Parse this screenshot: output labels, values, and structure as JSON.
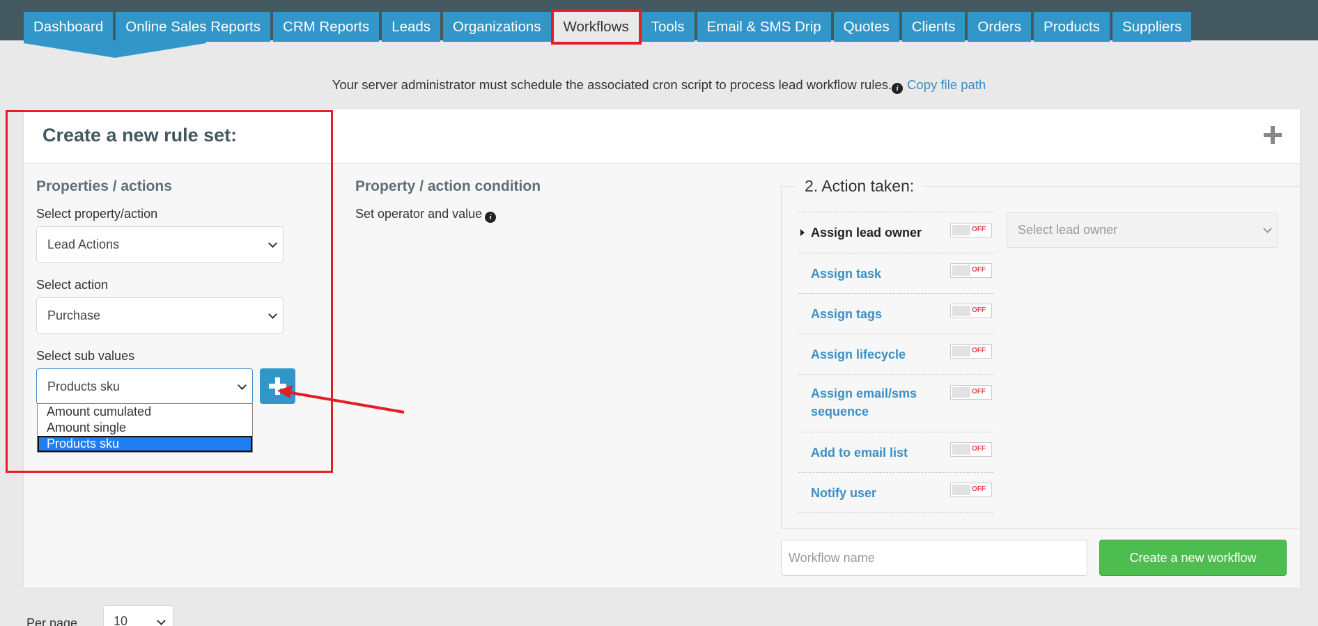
{
  "nav": {
    "items": [
      {
        "label": "Dashboard"
      },
      {
        "label": "Online Sales Reports"
      },
      {
        "label": "CRM Reports"
      },
      {
        "label": "Leads"
      },
      {
        "label": "Organizations"
      },
      {
        "label": "Workflows",
        "active": true
      },
      {
        "label": "Tools"
      },
      {
        "label": "Email & SMS Drip"
      },
      {
        "label": "Quotes"
      },
      {
        "label": "Clients"
      },
      {
        "label": "Orders"
      },
      {
        "label": "Products"
      },
      {
        "label": "Suppliers"
      }
    ]
  },
  "notice": {
    "text": "Your server administrator must schedule the associated cron script to process lead workflow rules.",
    "info_icon": "i",
    "link": "Copy file path"
  },
  "card": {
    "title": "Create a new rule set:",
    "properties": {
      "heading": "Properties / actions",
      "property_label": "Select property/action",
      "property_value": "Lead Actions",
      "action_label": "Select action",
      "action_value": "Purchase",
      "sub_label": "Select sub values",
      "sub_value": "Products sku",
      "sub_options": [
        "Amount cumulated",
        "Amount single",
        "Products sku"
      ]
    },
    "condition": {
      "heading": "Property / action condition",
      "label": "Set operator and value",
      "info_icon": "i"
    },
    "actions": {
      "legend": "2. Action taken:",
      "items": [
        {
          "label": "Assign lead owner",
          "state": "OFF"
        },
        {
          "label": "Assign task",
          "state": "OFF"
        },
        {
          "label": "Assign tags",
          "state": "OFF"
        },
        {
          "label": "Assign lifecycle",
          "state": "OFF"
        },
        {
          "label": "Assign email/sms",
          "label2": "sequence",
          "state": "OFF"
        },
        {
          "label": "Add to email list",
          "state": "OFF"
        },
        {
          "label": "Notify user",
          "state": "OFF"
        }
      ],
      "owner_placeholder": "Select lead owner"
    },
    "workflow_name_placeholder": "Workflow name",
    "create_button": "Create a new workflow"
  },
  "pagination": {
    "per_page_label": "Per page",
    "per_page_value": "10"
  },
  "colors": {
    "nav_blue": "#3296c9",
    "header_dark": "#44585f",
    "link_blue": "#3a8fc6",
    "green": "#4ebd4f",
    "annotation_red": "#e41e25"
  }
}
